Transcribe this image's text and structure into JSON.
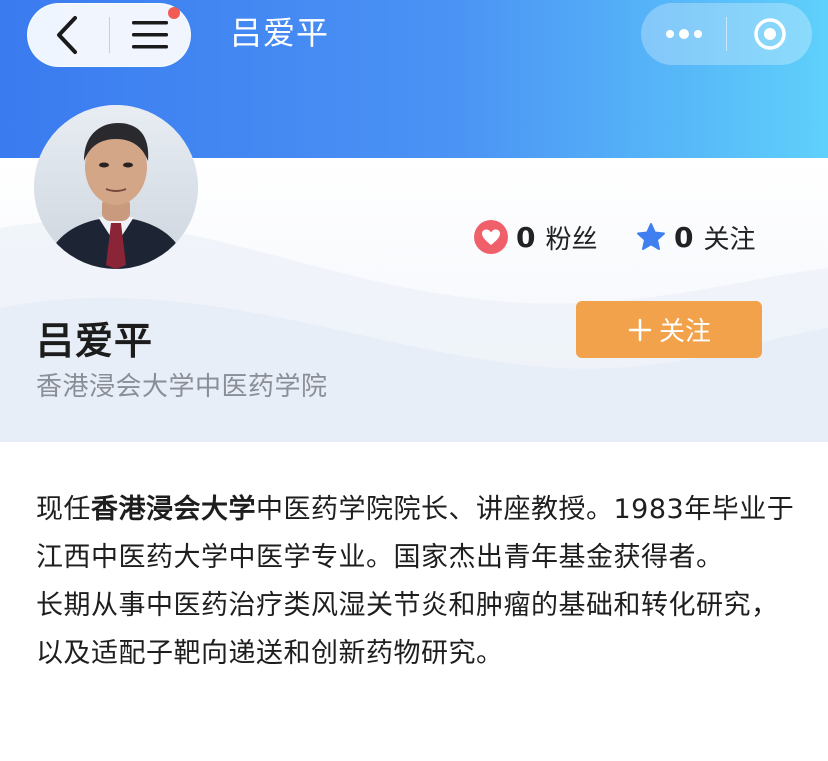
{
  "nav": {
    "back_icon": "chevron-left-icon",
    "menu_icon": "hamburger-menu-icon",
    "has_notification_dot": true,
    "title": "吕爱平"
  },
  "miniprogram": {
    "more_icon": "more-dots-icon",
    "close_icon": "target-circle-icon"
  },
  "profile": {
    "name": "吕爱平",
    "organization": "香港浸会大学中医药学院",
    "fans_count": "0",
    "fans_label": "粉丝",
    "follow_count": "0",
    "follow_label": "关注",
    "follow_button_label": "关注"
  },
  "bio": {
    "p1_prefix": "现任",
    "p1_bold": "香港浸会大学",
    "p1_suffix": "中医药学院院长、讲座教授。1983年毕业于江西中医药大学中医学专业。国家杰出青年基金获得者。",
    "p2": "长期从事中医药治疗类风湿关节炎和肿瘤的基础和转化研究，以及适配子靶向递送和创新药物研究。"
  },
  "colors": {
    "header_start": "#3a7bf0",
    "header_end": "#5fd0fb",
    "follow_button": "#f2a24a",
    "heart": "#f0606a",
    "star": "#3f7ff0",
    "notification_dot": "#f25c54"
  }
}
